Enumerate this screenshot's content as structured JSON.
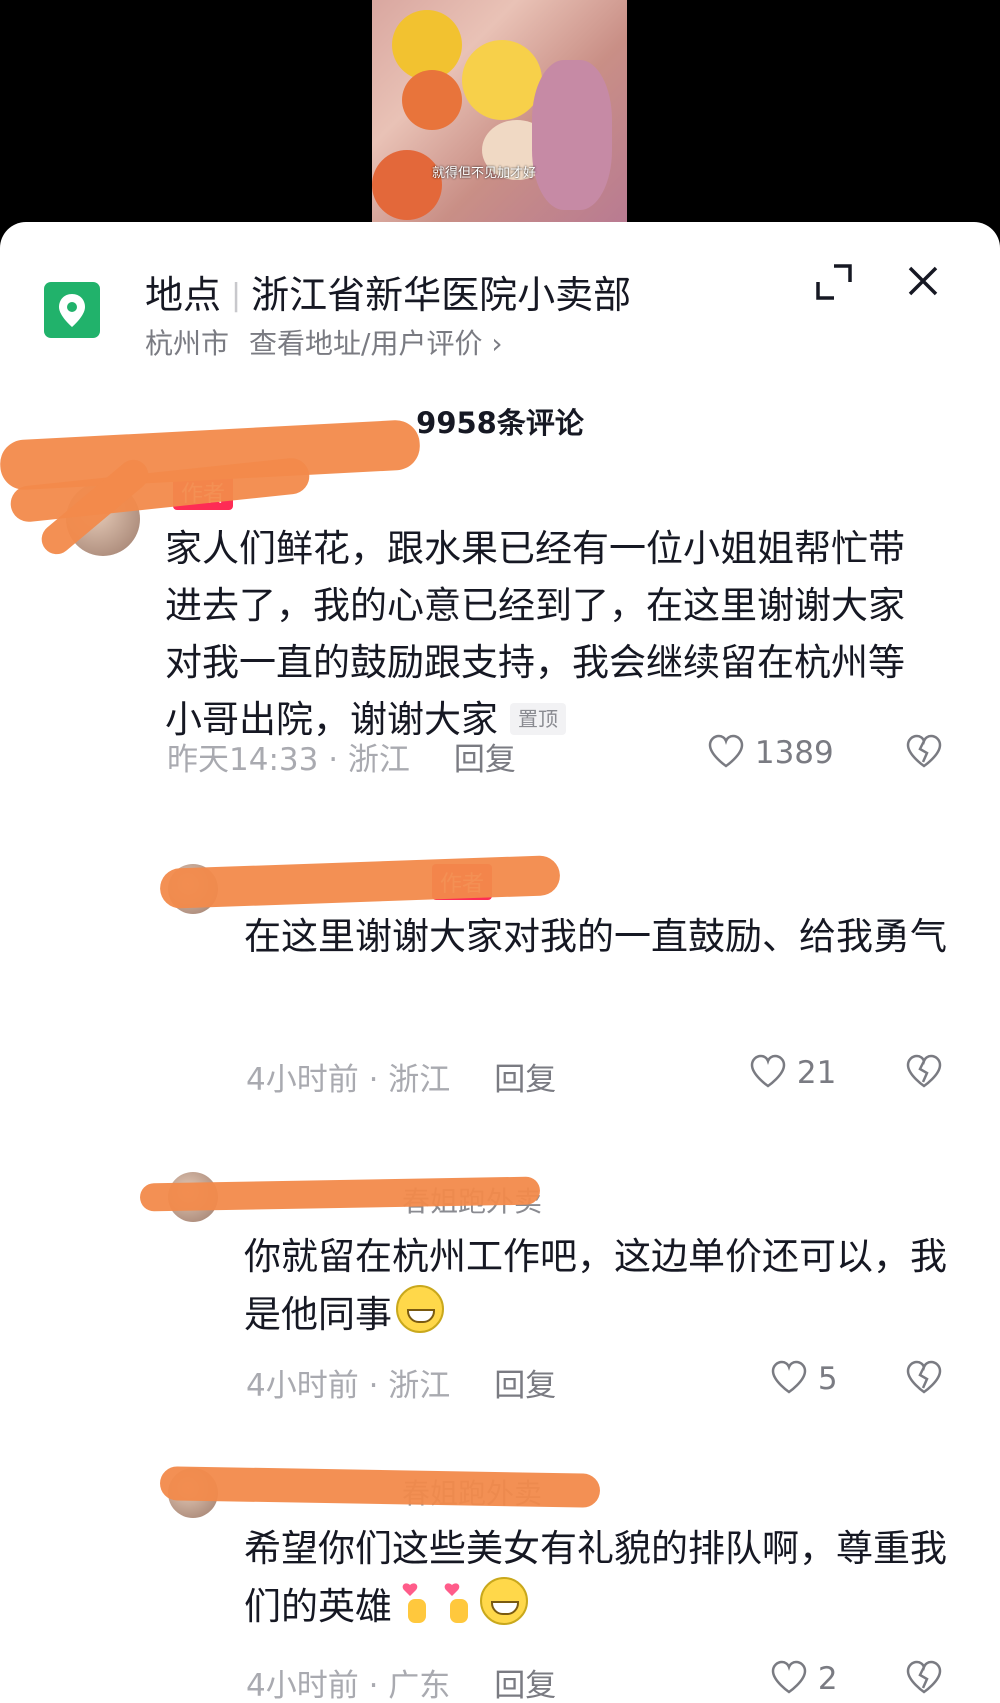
{
  "video": {
    "caption": "就得但不见加才好"
  },
  "location": {
    "label": "地点",
    "name": "浙江省新华医院小卖部",
    "city": "杭州市",
    "link": "查看地址/用户评价 ›"
  },
  "comment_count": "9958条评论",
  "comments": [
    {
      "author_badge": "作者",
      "text": "家人们鲜花，跟水果已经有一位小姐姐帮忙带进去了，我的心意已经到了，在这里谢谢大家对我一直的鼓励跟支持，我会继续留在杭州等小哥出院，谢谢大家",
      "pinned": "置顶",
      "time": "昨天14:33 · 浙江",
      "reply": "回复",
      "likes": "1389"
    },
    {
      "author_badge": "作者",
      "text": "在这里谢谢大家对我的一直鼓励、给我勇气",
      "time": "4小时前 · 浙江",
      "reply": "回复",
      "likes": "21"
    },
    {
      "reply_to": "春姐跑外卖",
      "text": "你就留在杭州工作吧，这边单价还可以，我是他同事",
      "time": "4小时前 · 浙江",
      "reply": "回复",
      "likes": "5"
    },
    {
      "reply_to": "春姐跑外卖",
      "text": "希望你们这些美女有礼貌的排队啊，尊重我们的英雄",
      "time": "4小时前 · 广东",
      "reply": "回复",
      "likes": "2"
    }
  ],
  "colors": {
    "accent": "#fe2c55",
    "location_icon": "#21b26b",
    "redaction": "#f28a4b",
    "meta_text": "#a9aab0"
  },
  "icons": [
    "location-pin-icon",
    "expand-icon",
    "close-icon",
    "heart-icon",
    "broken-heart-icon",
    "grin-emoji",
    "finger-heart-emoji"
  ]
}
